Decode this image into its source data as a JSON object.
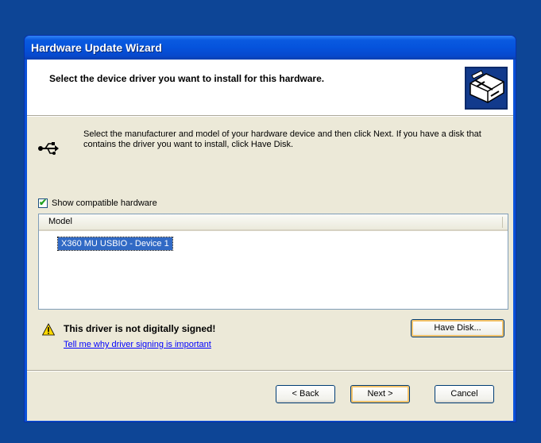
{
  "window": {
    "title": "Hardware Update Wizard"
  },
  "header": {
    "heading": "Select the device driver you want to install for this hardware."
  },
  "instructions": "Select the manufacturer and model of your hardware device and then click Next. If you have a disk that contains the driver you want to install, click Have Disk.",
  "compatible": {
    "label": "Show compatible hardware",
    "checked": true
  },
  "model_list": {
    "column_header": "Model",
    "items": [
      "X360 MU USBIO - Device 1"
    ],
    "selected_index": 0
  },
  "warning": {
    "text": "This driver is not digitally signed!",
    "link": "Tell me why driver signing is important"
  },
  "buttons": {
    "have_disk": "Have Disk...",
    "back": "< Back",
    "next": "Next >",
    "cancel": "Cancel"
  },
  "icons": {
    "header": "hardware-card-icon",
    "connection": "usb-icon",
    "warning": "warning-icon"
  },
  "colors": {
    "titlebar": "#0553dc",
    "selection": "#316ac5",
    "dialog_bg": "#ece9d8",
    "link": "#0000ff"
  }
}
